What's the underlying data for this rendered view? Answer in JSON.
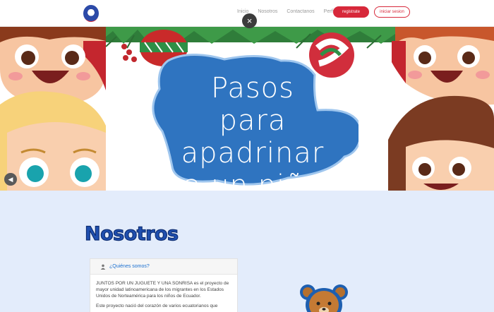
{
  "header": {
    "logo_icon": "logo-emblem",
    "nav": [
      "Inicio",
      "Nosotros",
      "Contactanos",
      "Perfiles"
    ],
    "register_label": "registrate",
    "login_label": "iniciar sesion",
    "accent_color": "#d7283a"
  },
  "overlay": {
    "close_label": "×"
  },
  "banner": {
    "title_lines": [
      "Pasos",
      "para apadrinar",
      "a un niño"
    ],
    "volume_icon": "speaker-icon"
  },
  "about": {
    "section_title": "Nosotros",
    "card_title": "¿Quiénes somos?",
    "paragraphs": [
      "JUNTOS POR UN JUGUETE Y UNA SONRISA es el proyecto de mayor unidad latinoamericana de los migrantes en los Estados Unidos de Norteamérica para los niños de Ecuador.",
      "Este proyecto nació del corazón de varios ecuatorianos que"
    ]
  }
}
